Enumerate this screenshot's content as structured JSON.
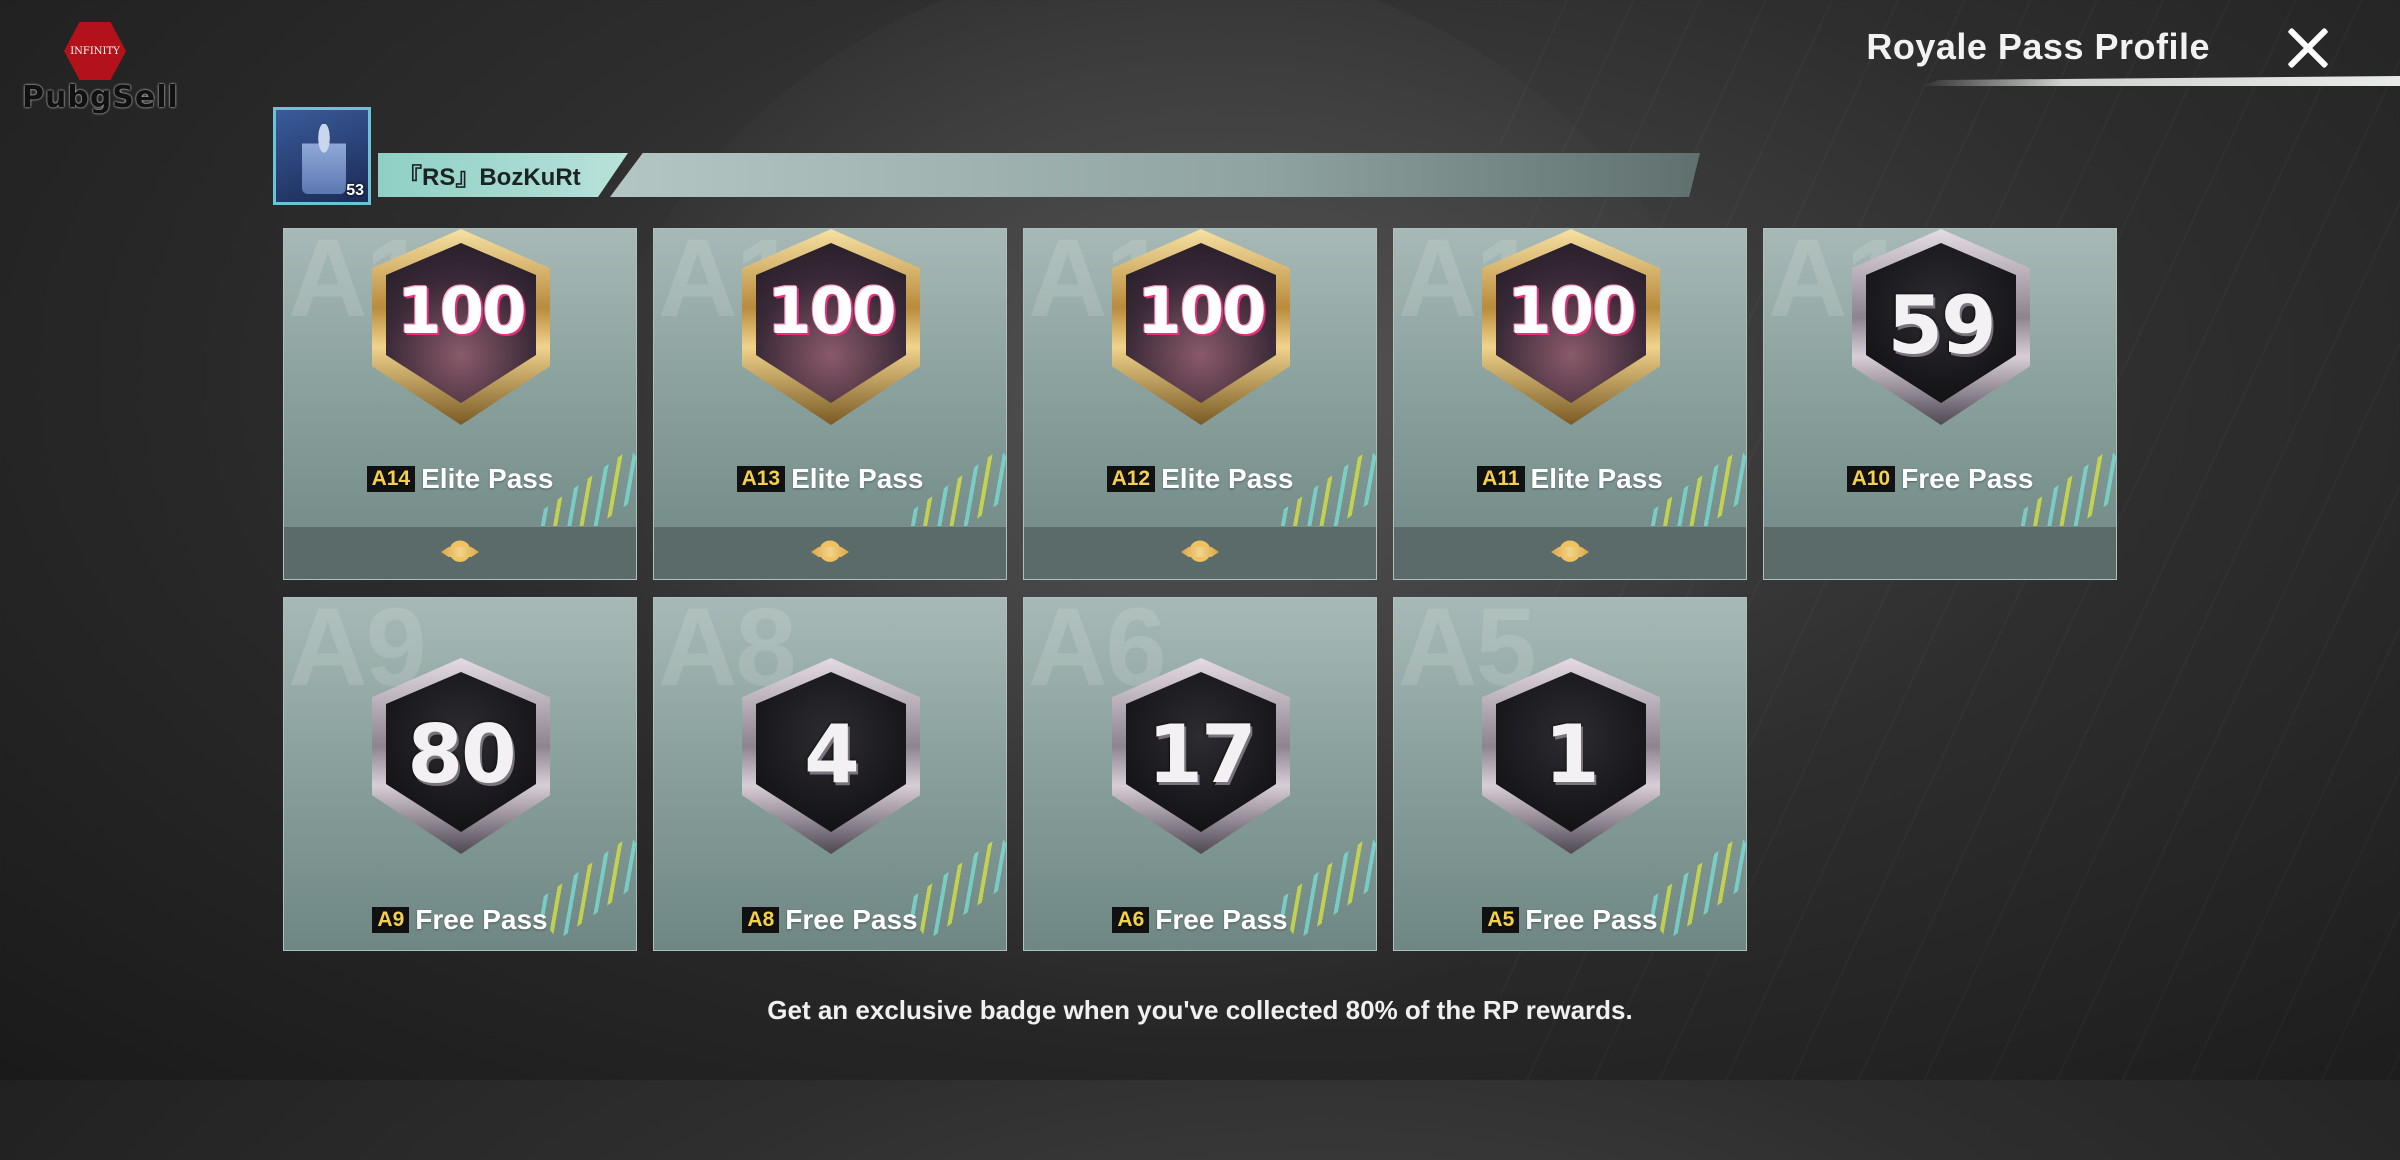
{
  "logo": {
    "seal_text": "INFINITY",
    "text": "PubgSell"
  },
  "header": {
    "title": "Royale Pass Profile"
  },
  "profile": {
    "level": "53",
    "name": "『RS』BozKuRt"
  },
  "cards": [
    {
      "season": "A14",
      "watermark": "A14",
      "pass": "Elite Pass",
      "badge": "100",
      "badge_style": "gold",
      "rp_icon": true
    },
    {
      "season": "A13",
      "watermark": "A13",
      "pass": "Elite Pass",
      "badge": "100",
      "badge_style": "gold",
      "rp_icon": true
    },
    {
      "season": "A12",
      "watermark": "A12",
      "pass": "Elite Pass",
      "badge": "100",
      "badge_style": "gold",
      "rp_icon": true
    },
    {
      "season": "A11",
      "watermark": "A11",
      "pass": "Elite Pass",
      "badge": "100",
      "badge_style": "gold",
      "rp_icon": true
    },
    {
      "season": "A10",
      "watermark": "A10",
      "pass": "Free Pass",
      "badge": "59",
      "badge_style": "silver",
      "rp_icon": false
    },
    {
      "season": "A9",
      "watermark": "A9",
      "pass": "Free Pass",
      "badge": "80",
      "badge_style": "silver"
    },
    {
      "season": "A8",
      "watermark": "A8",
      "pass": "Free Pass",
      "badge": "4",
      "badge_style": "silver"
    },
    {
      "season": "A6",
      "watermark": "A6",
      "pass": "Free Pass",
      "badge": "17",
      "badge_style": "silver"
    },
    {
      "season": "A5",
      "watermark": "A5",
      "pass": "Free Pass",
      "badge": "1",
      "badge_style": "silver"
    }
  ],
  "footer": {
    "note": "Get an exclusive badge when you've collected 80% of the RP rewards."
  }
}
